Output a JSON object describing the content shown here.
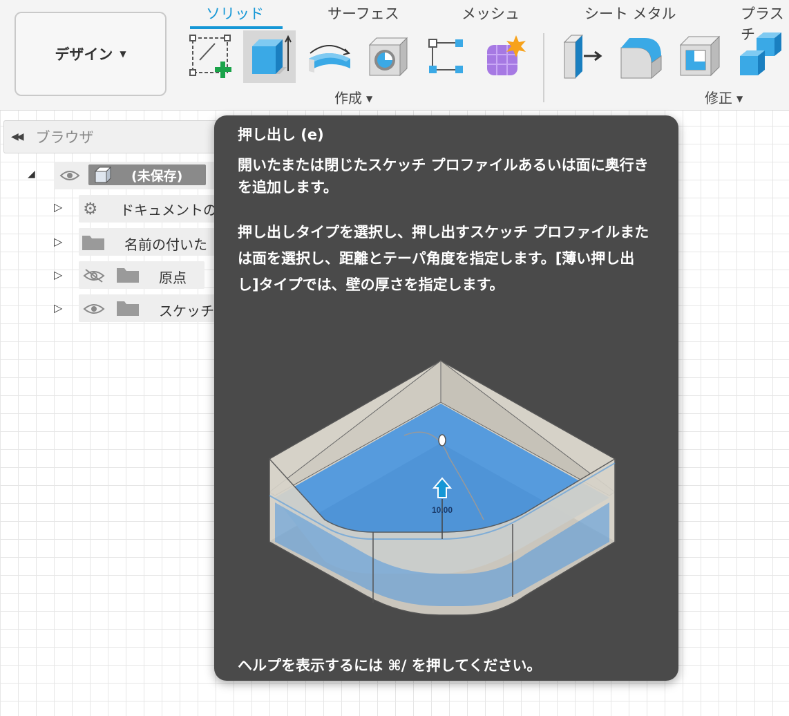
{
  "toolbar": {
    "workspace_label": "デザイン",
    "tabs": [
      {
        "label": "ソリッド",
        "active": true
      },
      {
        "label": "サーフェス",
        "active": false
      },
      {
        "label": "メッシュ",
        "active": false
      },
      {
        "label": "シート メタル",
        "active": false
      },
      {
        "label": "プラスチ",
        "active": false
      }
    ],
    "groups": {
      "create_label": "作成",
      "modify_label": "修正"
    },
    "tools": [
      {
        "icon": "create-sketch-icon"
      },
      {
        "icon": "extrude-icon",
        "selected": true
      },
      {
        "icon": "revolve-icon"
      },
      {
        "icon": "hole-icon"
      },
      {
        "icon": "pattern-icon"
      },
      {
        "icon": "create-form-icon"
      },
      {
        "icon": "press-pull-icon"
      },
      {
        "icon": "fillet-icon"
      },
      {
        "icon": "shell-icon"
      },
      {
        "icon": "combine-icon"
      }
    ],
    "accent_color": "#1597d6"
  },
  "browser": {
    "title": "ブラウザ",
    "root": {
      "label": "(未保存)"
    },
    "items": [
      {
        "label": "ドキュメントの",
        "icon": "gear-icon"
      },
      {
        "label": "名前の付いた",
        "icon": "folder-icon"
      },
      {
        "label": "原点",
        "icon": "folder-icon",
        "visibility": "hidden"
      },
      {
        "label": "スケッチ",
        "icon": "folder-icon",
        "visibility": "visible"
      }
    ]
  },
  "tooltip": {
    "title": "押し出し (e)",
    "description": "開いたまたは閉じたスケッチ プロファイルあるいは面に奥行きを追加します。",
    "details": "押し出しタイプを選択し、押し出すスケッチ プロファイルまたは面を選択し、距離とテーパ角度を指定します。[薄い押し出し]タイプでは、壁の厚さを指定します。",
    "figure_value": "10.00",
    "help": "ヘルプを表示するには ⌘/ を押してください。",
    "background_color": "#4a4a4a"
  }
}
